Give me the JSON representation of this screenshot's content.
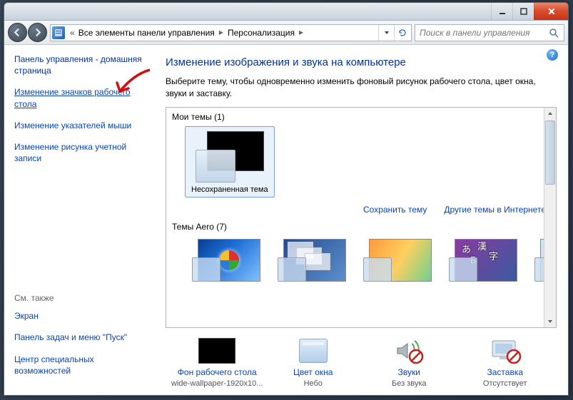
{
  "titlebar": {
    "min": "–",
    "max": "▢",
    "close": "✕"
  },
  "breadcrumb": {
    "chevrons": "«",
    "items": [
      "Все элементы панели управления",
      "Персонализация"
    ]
  },
  "search": {
    "placeholder": "Поиск в панели управления"
  },
  "sidebar": {
    "home": "Панель управления - домашняя страница",
    "links": [
      "Изменение значков рабочего стола",
      "Изменение указателей мыши",
      "Изменение рисунка учетной записи"
    ],
    "see_also": "См. также",
    "see_links": [
      "Экран",
      "Панель задач и меню \"Пуск\"",
      "Центр специальных возможностей"
    ]
  },
  "main": {
    "title": "Изменение изображения и звука на компьютере",
    "subtitle": "Выберите тему, чтобы одновременно изменить фоновый рисунок рабочего стола, цвет окна, звуки и заставку.",
    "my_themes_label": "Мои темы (1)",
    "unsaved_theme": "Несохраненная тема",
    "save_theme": "Сохранить тему",
    "more_themes": "Другие темы в Интернете",
    "aero_label": "Темы Aero (7)"
  },
  "bottom": {
    "bg": {
      "label": "Фон рабочего стола",
      "value": "wide-wallpaper-1920x10..."
    },
    "color": {
      "label": "Цвет окна",
      "value": "Небо"
    },
    "sound": {
      "label": "Звуки",
      "value": "Без звука"
    },
    "saver": {
      "label": "Заставка",
      "value": "Отсутствует"
    }
  }
}
